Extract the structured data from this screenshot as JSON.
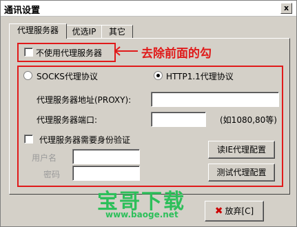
{
  "window": {
    "title": "通讯设置",
    "close_label": "x"
  },
  "tabs": [
    {
      "label": "代理服务器",
      "active": true
    },
    {
      "label": "优选IP",
      "active": false
    },
    {
      "label": "其它",
      "active": false
    }
  ],
  "no_proxy_checkbox": {
    "label": "不使用代理服务器",
    "checked": false
  },
  "annotation": "去除前面的勾",
  "protocol": {
    "socks_label": "SOCKS代理协议",
    "http_label": "HTTP1.1代理协议",
    "selected": "HTTP1.1代理协议"
  },
  "proxy_address": {
    "label": "代理服务器地址(PROXY):",
    "value": ""
  },
  "proxy_port": {
    "label": "代理服务器端口:",
    "value": "",
    "hint": "(如1080,80等)"
  },
  "auth": {
    "label": "代理服务器需要身份验证",
    "checked": false
  },
  "username": {
    "label": "用户名",
    "value": ""
  },
  "password": {
    "label": "密码",
    "value": ""
  },
  "buttons": {
    "read_ie": "读IE代理配置",
    "test": "测试代理配置",
    "cancel": "放弃[C]"
  },
  "watermark": {
    "text": "宝哥下载",
    "url": "www.baoge.net"
  },
  "colors": {
    "annotation_red": "#e01a1a",
    "watermark_green": "#2dbf5a",
    "dialog_bg": "#d4d0c8"
  }
}
